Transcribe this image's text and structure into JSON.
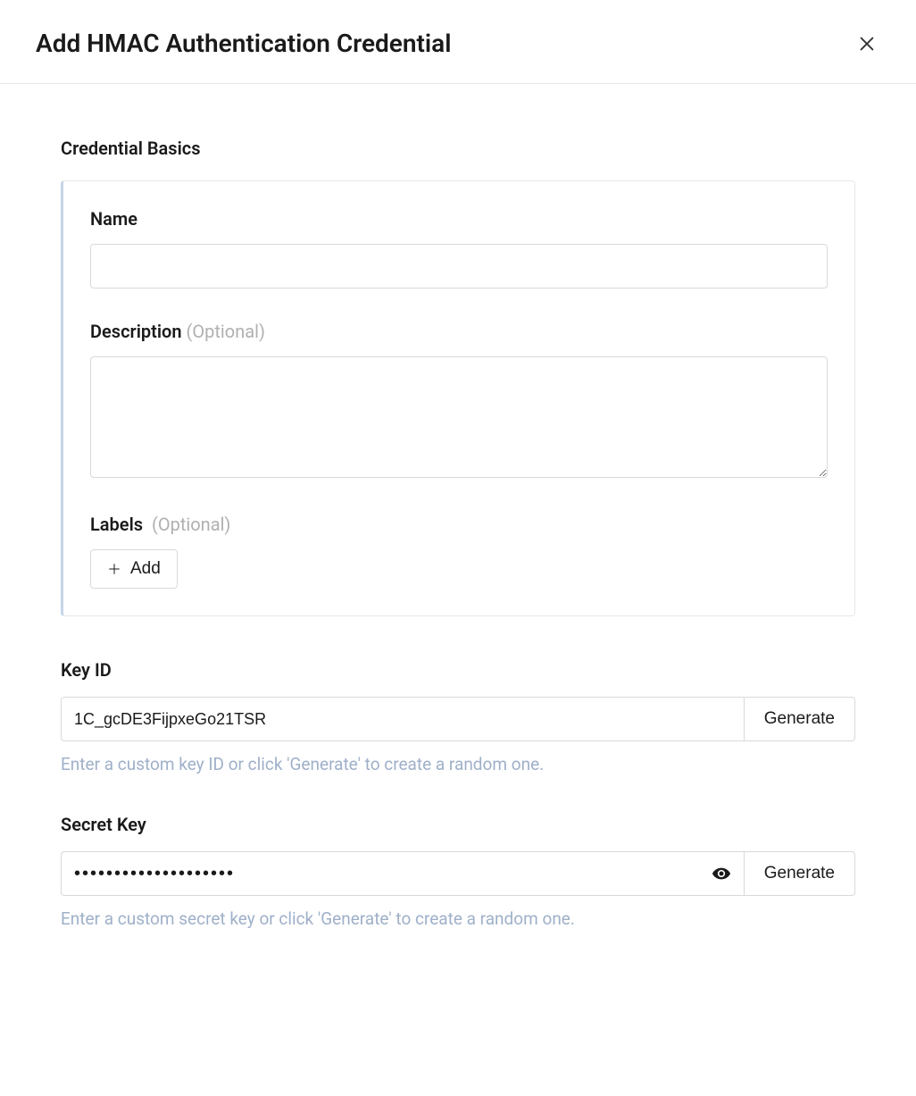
{
  "header": {
    "title": "Add HMAC Authentication Credential"
  },
  "sections": {
    "basics": {
      "title": "Credential Basics",
      "name": {
        "label": "Name",
        "value": ""
      },
      "description": {
        "label": "Description",
        "optional": "(Optional)",
        "value": ""
      },
      "labels": {
        "label": "Labels",
        "optional": "(Optional)",
        "add_button": "Add"
      }
    },
    "key_id": {
      "label": "Key ID",
      "value": "1C_gcDE3FijpxeGo21TSR",
      "generate_button": "Generate",
      "helper": "Enter a custom key ID or click 'Generate' to create a random one."
    },
    "secret_key": {
      "label": "Secret Key",
      "value": "••••••••••••••••••••",
      "generate_button": "Generate",
      "helper": "Enter a custom secret key or click 'Generate' to create a random one."
    }
  }
}
